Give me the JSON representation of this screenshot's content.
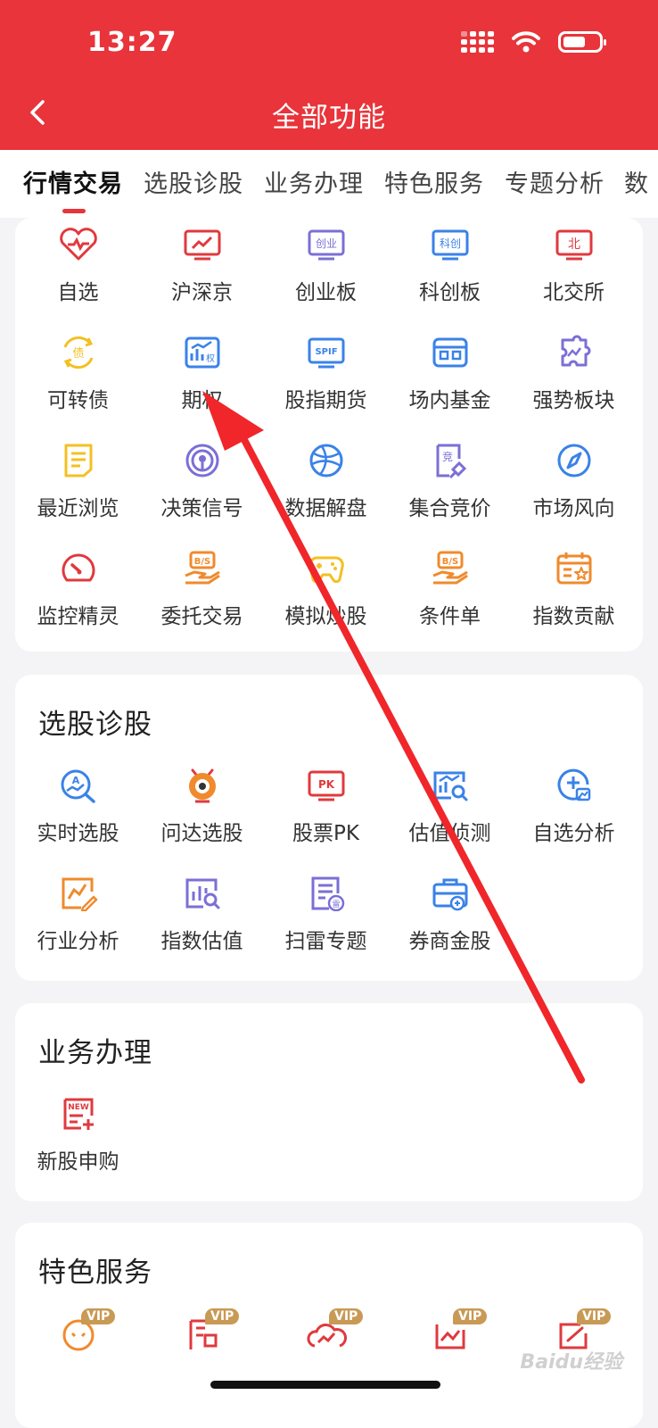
{
  "status_bar": {
    "time": "13:27"
  },
  "header": {
    "title": "全部功能"
  },
  "tabs": [
    {
      "label": "行情交易"
    },
    {
      "label": "选股诊股"
    },
    {
      "label": "业务办理"
    },
    {
      "label": "特色服务"
    },
    {
      "label": "专题分析"
    },
    {
      "label": "数"
    }
  ],
  "sections": [
    {
      "title": "",
      "items": [
        {
          "label": "自选",
          "icon": "heart-chart-icon"
        },
        {
          "label": "沪深京",
          "icon": "monitor-trend-icon"
        },
        {
          "label": "创业板",
          "icon": "chuangye-board-icon"
        },
        {
          "label": "科创板",
          "icon": "kechuang-board-icon"
        },
        {
          "label": "北交所",
          "icon": "bei-exchange-icon"
        },
        {
          "label": "可转债",
          "icon": "convertible-bond-icon"
        },
        {
          "label": "期权",
          "icon": "option-chart-icon"
        },
        {
          "label": "股指期货",
          "icon": "spif-icon"
        },
        {
          "label": "场内基金",
          "icon": "fund-box-icon"
        },
        {
          "label": "强势板块",
          "icon": "puzzle-icon"
        },
        {
          "label": "最近浏览",
          "icon": "document-icon"
        },
        {
          "label": "决策信号",
          "icon": "signal-radar-icon"
        },
        {
          "label": "数据解盘",
          "icon": "globe-network-icon"
        },
        {
          "label": "集合竞价",
          "icon": "auction-hammer-icon"
        },
        {
          "label": "市场风向",
          "icon": "compass-icon"
        },
        {
          "label": "监控精灵",
          "icon": "speedometer-icon"
        },
        {
          "label": "委托交易",
          "icon": "bs-hand-icon"
        },
        {
          "label": "模拟炒股",
          "icon": "gamepad-icon"
        },
        {
          "label": "条件单",
          "icon": "bs-hand-icon"
        },
        {
          "label": "指数贡献",
          "icon": "calendar-star-icon"
        }
      ]
    },
    {
      "title": "选股诊股",
      "items": [
        {
          "label": "实时选股",
          "icon": "a-search-icon"
        },
        {
          "label": "问达选股",
          "icon": "robot-icon"
        },
        {
          "label": "股票PK",
          "icon": "pk-monitor-icon"
        },
        {
          "label": "估值侦测",
          "icon": "chart-search-icon"
        },
        {
          "label": "自选分析",
          "icon": "plus-chart-icon"
        },
        {
          "label": "行业分析",
          "icon": "line-edit-icon"
        },
        {
          "label": "指数估值",
          "icon": "bar-search-icon"
        },
        {
          "label": "扫雷专题",
          "icon": "doc-mine-icon"
        },
        {
          "label": "券商金股",
          "icon": "briefcase-icon"
        }
      ]
    },
    {
      "title": "业务办理",
      "items": [
        {
          "label": "新股申购",
          "icon": "new-stock-icon"
        }
      ]
    },
    {
      "title": "特色服务",
      "items": [
        {
          "label": "",
          "icon": "vip-face-icon",
          "badge": "VIP"
        },
        {
          "label": "",
          "icon": "vip-doc-icon",
          "badge": "VIP"
        },
        {
          "label": "",
          "icon": "vip-cloud-icon",
          "badge": "VIP"
        },
        {
          "label": "",
          "icon": "vip-chart-icon",
          "badge": "VIP"
        },
        {
          "label": "",
          "icon": "vip-arrow-icon",
          "badge": "VIP"
        }
      ]
    }
  ],
  "watermark": "Baidu经验",
  "colors": {
    "header": "#e8343a",
    "accent_red": "#e0393e",
    "accent_blue": "#3a82e8",
    "accent_orange": "#f08a2c",
    "accent_purple": "#7b6fd6",
    "accent_yellow": "#f4c021"
  }
}
